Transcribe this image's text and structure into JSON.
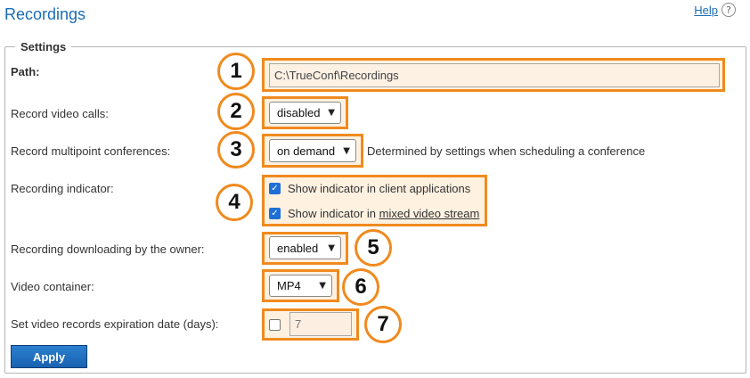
{
  "page": {
    "title": "Recordings",
    "help_label": "Help",
    "help_icon": "?"
  },
  "settings": {
    "legend": "Settings",
    "path": {
      "label": "Path:",
      "value": "C:\\TrueConf\\Recordings",
      "marker": "1"
    },
    "record_video_calls": {
      "label": "Record video calls:",
      "selected": "disabled",
      "marker": "2"
    },
    "record_multipoint": {
      "label": "Record multipoint conferences:",
      "selected": "on demand",
      "note": "Determined by settings when scheduling a conference",
      "marker": "3"
    },
    "recording_indicator": {
      "label": "Recording indicator:",
      "marker": "4",
      "options": [
        {
          "label": "Show indicator in client applications",
          "checked": true
        },
        {
          "label_prefix": "Show indicator in ",
          "link": "mixed video stream",
          "checked": true
        }
      ]
    },
    "downloading_by_owner": {
      "label": "Recording downloading by the owner:",
      "selected": "enabled",
      "marker": "5"
    },
    "video_container": {
      "label": "Video container:",
      "selected": "MP4",
      "marker": "6"
    },
    "expiration": {
      "label": "Set video records expiration date (days):",
      "checked": false,
      "value": "7",
      "marker": "7"
    },
    "apply_label": "Apply"
  },
  "colors": {
    "accent": "#f08a1e",
    "highlight_bg": "#fff1e0",
    "title": "#1a6db5",
    "button": "#1862b0",
    "checkbox": "#1f6fd8"
  }
}
